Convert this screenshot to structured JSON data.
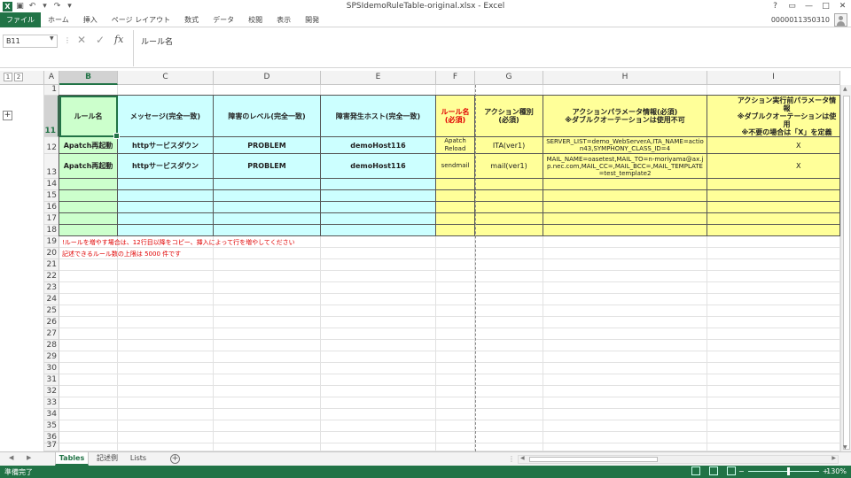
{
  "window": {
    "title": "SPSIdemoRuleTable-original.xlsx - Excel",
    "controls": [
      "?",
      "▭",
      "—",
      "□",
      "✕"
    ]
  },
  "ribbon": {
    "tabs": [
      "ファイル",
      "ホーム",
      "挿入",
      "ページ レイアウト",
      "数式",
      "データ",
      "校閲",
      "表示",
      "開発"
    ],
    "user": "0000011350310"
  },
  "formula_bar": {
    "name_box": "B11",
    "content": "ルール名"
  },
  "columns": [
    "A",
    "B",
    "C",
    "D",
    "E",
    "F",
    "G",
    "H",
    "I"
  ],
  "selected_column": "B",
  "rows": [
    "1",
    "11",
    "12",
    "13",
    "14",
    "15",
    "16",
    "17",
    "18",
    "19",
    "20",
    "21",
    "22",
    "23",
    "24",
    "25",
    "26",
    "27",
    "28",
    "29",
    "30",
    "31",
    "32",
    "33",
    "34",
    "35",
    "36",
    "37"
  ],
  "selected_row": "11",
  "table": {
    "headers": [
      "ルール名",
      "メッセージ(完全一致)",
      "障害のレベル(完全一致)",
      "障害発生ホスト(完全一致)",
      "ルール名\n(必須)",
      "アクション種別\n(必須)",
      "アクションパラメータ情報(必須)\n※ダブルクオーテーションは使用不可",
      "アクション実行前パラメータ情報\n※ダブルクオーテーションは使用\n※不要の場合は「X」を定義"
    ],
    "rows": [
      [
        "Apatch再起動",
        "httpサービスダウン",
        "PROBLEM",
        "demoHost116",
        "Apatch\nReload",
        "ITA(ver1)",
        "SERVER_LIST=demo_WebServerA,ITA_NAME=action43,SYMPHONY_CLASS_ID=4",
        "X"
      ],
      [
        "Apatch再起動",
        "httpサービスダウン",
        "PROBLEM",
        "demoHost116",
        "sendmail",
        "mail(ver1)",
        "MAIL_NAME=oasetest,MAIL_TO=n-moriyama@ax.jp.nec.com,MAIL_CC=,MAIL_BCC=,MAIL_TEMPLATE=test_template2",
        "X"
      ]
    ]
  },
  "notes": [
    "!ルールを増やす場合は、12行目以降をコピー、挿入によって行を増やしてください",
    "記述できるルール数の上限は 5000 件です"
  ],
  "sheets": {
    "tabs": [
      "Tables",
      "記述例",
      "Lists"
    ],
    "active": "Tables"
  },
  "status": {
    "ready": "準備完了",
    "zoom": "130%"
  },
  "colors": {
    "excel_green": "#217346",
    "green_fill": "#ccffcc",
    "cyan_fill": "#ccffff",
    "yellow_fill": "#ffff99",
    "required_red": "#e00000"
  }
}
